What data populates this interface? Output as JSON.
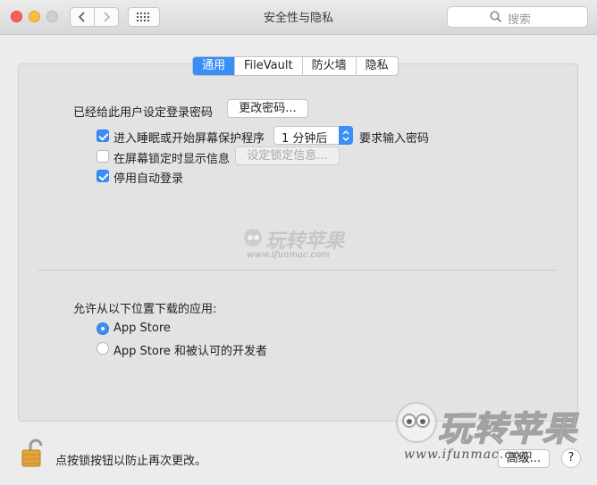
{
  "window": {
    "title": "安全性与隐私",
    "search_placeholder": "搜索"
  },
  "tabs": [
    {
      "label": "通用",
      "active": true
    },
    {
      "label": "FileVault",
      "active": false
    },
    {
      "label": "防火墙",
      "active": false
    },
    {
      "label": "隐私",
      "active": false
    }
  ],
  "general": {
    "password_set_text": "已经给此用户设定登录密码",
    "change_password_button": "更改密码...",
    "require_password": {
      "checked": true,
      "label": "进入睡眠或开始屏幕保护程序",
      "delay_value": "1 分钟后",
      "suffix": "要求输入密码"
    },
    "show_message": {
      "checked": false,
      "label": "在屏幕锁定时显示信息",
      "button": "设定锁定信息..."
    },
    "disable_autologin": {
      "checked": true,
      "label": "停用自动登录"
    }
  },
  "downloads": {
    "heading": "允许从以下位置下载的应用:",
    "options": [
      {
        "label": "App Store",
        "selected": true
      },
      {
        "label": "App Store 和被认可的开发者",
        "selected": false
      }
    ]
  },
  "watermark": {
    "brand": "玩转苹果",
    "url": "www.ifunmac.com"
  },
  "footer": {
    "lock_text": "点按锁按钮以防止再次更改。",
    "advanced_button": "高级...",
    "help_button": "?"
  },
  "colors": {
    "accent": "#3a8ef7",
    "lock": "#e3a43a"
  }
}
